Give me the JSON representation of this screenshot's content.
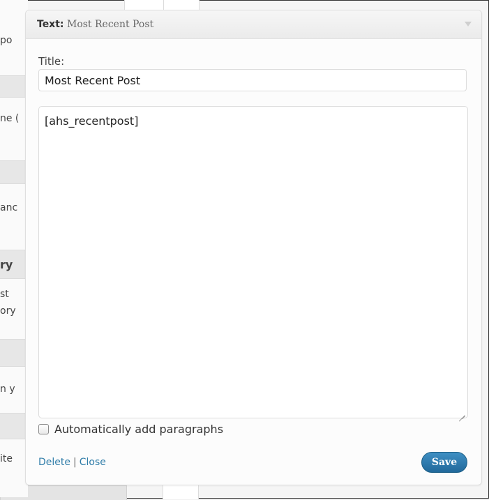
{
  "background": {
    "rows": [
      "po",
      "ne (",
      "anc",
      "ry",
      "st",
      "ory",
      "n y",
      "ite"
    ]
  },
  "widget": {
    "name": "Text",
    "separator": ":",
    "subtitle": "Most Recent Post",
    "title_label": "Title:",
    "title_value": "Most Recent Post",
    "content_value": "[ahs_recentpost]",
    "auto_paragraphs_label": "Automatically add paragraphs",
    "auto_paragraphs_checked": false,
    "delete_label": "Delete",
    "link_separator": "|",
    "close_label": "Close",
    "save_label": "Save"
  },
  "colors": {
    "accent": "#2e7ca8",
    "save_button": "#21699b"
  }
}
